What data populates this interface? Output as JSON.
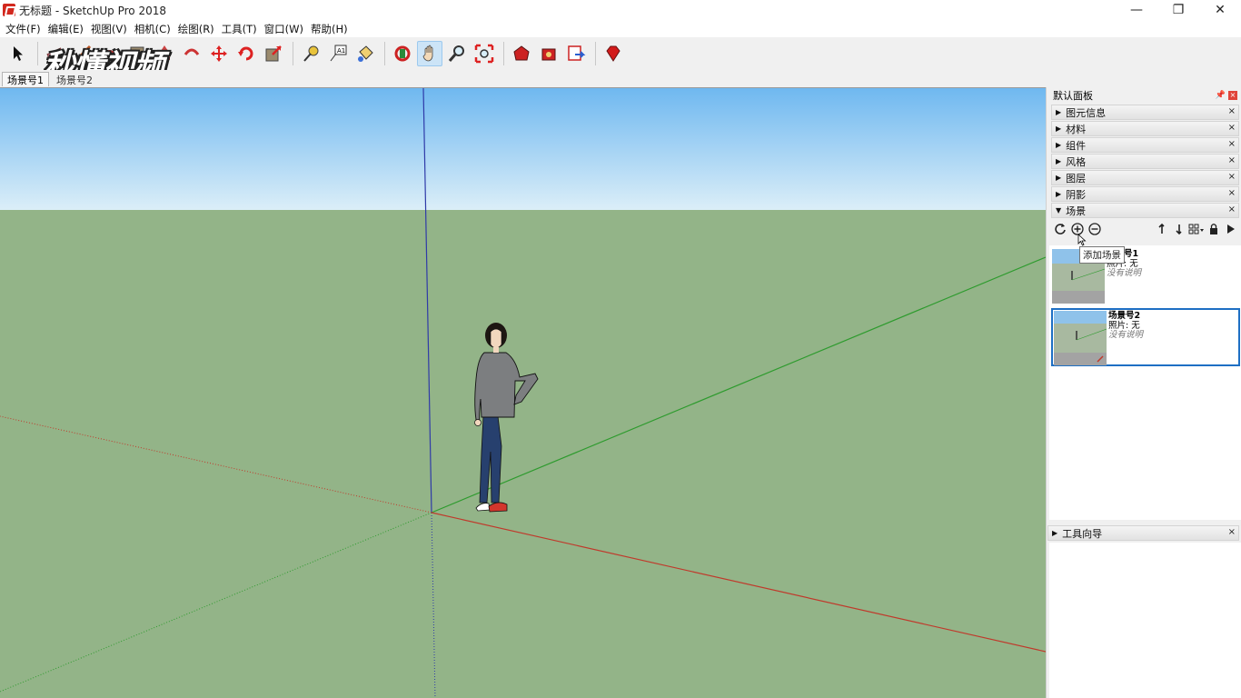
{
  "window": {
    "title": "无标题 - SketchUp Pro 2018",
    "minimize": "—",
    "maximize": "❐",
    "close": "✕"
  },
  "menu": [
    "文件(F)",
    "编辑(E)",
    "视图(V)",
    "相机(C)",
    "绘图(R)",
    "工具(T)",
    "窗口(W)",
    "帮助(H)"
  ],
  "watermark": "秒懂视频",
  "scene_tabs": [
    "场景号1",
    "场景号2"
  ],
  "tray": {
    "title": "默认面板",
    "panels": [
      "图元信息",
      "材料",
      "组件",
      "风格",
      "图层",
      "阴影",
      "场景"
    ],
    "expanded_panel": "场景",
    "tooltip": "添加场景",
    "scenes": [
      {
        "name": "场景号1",
        "photo": "照片: 无",
        "description": "没有说明",
        "selected": false
      },
      {
        "name": "场景号2",
        "photo": "照片: 无",
        "description": "没有说明",
        "selected": true
      }
    ],
    "bottom_panel": "工具向导"
  },
  "colors": {
    "sky_top": "#6fb8f0",
    "sky_bottom": "#d8ecf7",
    "ground": "#93b488",
    "axis_red": "#c0392b",
    "axis_green": "#2e9b2e",
    "axis_blue": "#2f3aa8",
    "selection": "#1e6fc4"
  }
}
